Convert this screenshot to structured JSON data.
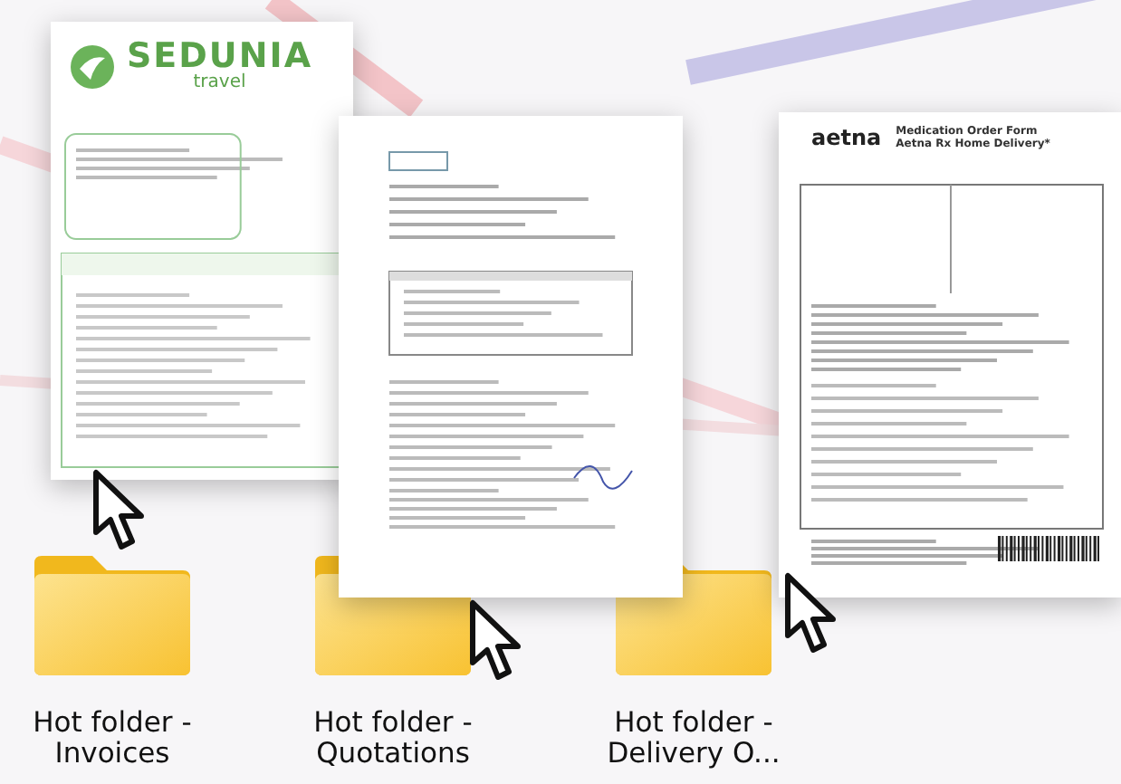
{
  "documents": [
    {
      "kind": "invoice",
      "brand": "SEDUNIA",
      "brand_sub": "travel"
    },
    {
      "kind": "quotation"
    },
    {
      "kind": "order-form",
      "brand": "aetna",
      "title": "Medication Order Form",
      "subtitle": "Aetna Rx Home Delivery*"
    }
  ],
  "folders": [
    {
      "label": "Hot folder - Invoices"
    },
    {
      "label": "Hot folder - Quotations"
    },
    {
      "label": "Hot folder - Delivery O..."
    }
  ]
}
